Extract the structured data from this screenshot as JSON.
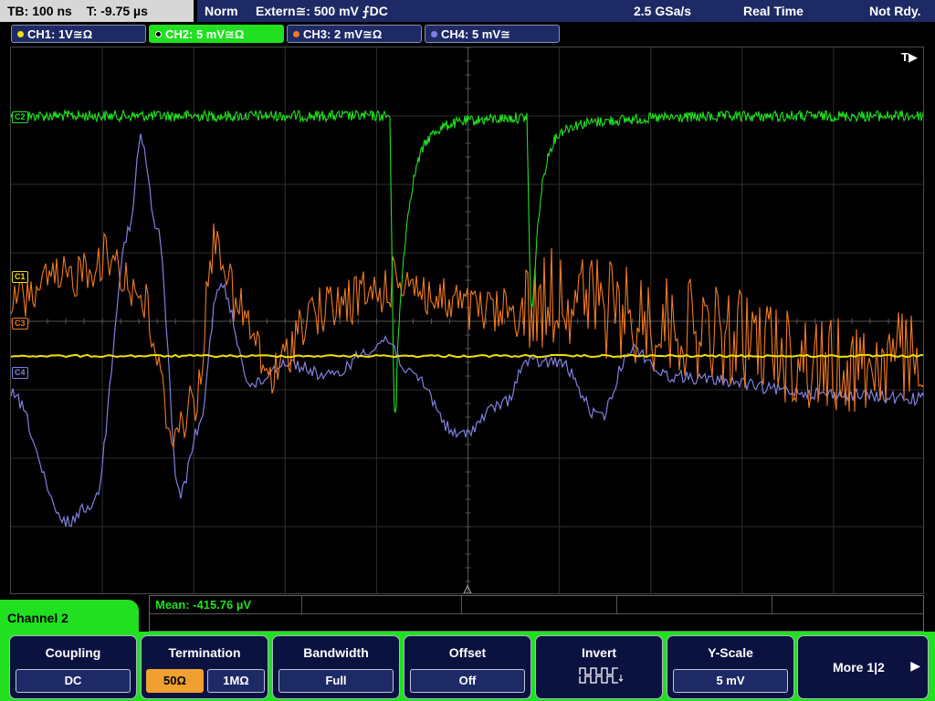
{
  "status": {
    "timebase": "TB: 100 ns",
    "trigger_time": "T: -9.75 µs",
    "mode": "Norm",
    "trigger_source": "Extern≅: 500 mV ⨍DC",
    "sample_rate": "2.5 GSa/s",
    "acq_mode": "Real Time",
    "state": "Not Rdy."
  },
  "channels": [
    {
      "label": "CH1: 1V≅Ω",
      "color": "#f0e000"
    },
    {
      "label": "CH2: 5 mV≅Ω",
      "color": "#20e020"
    },
    {
      "label": "CH3: 2 mV≅Ω",
      "color": "#f07a20"
    },
    {
      "label": "CH4: 5 mV≅",
      "color": "#8080e0"
    }
  ],
  "plot": {
    "trigger_marker": "T▶",
    "markers": [
      {
        "label": "C2"
      },
      {
        "label": "C1"
      },
      {
        "label": "C3"
      },
      {
        "label": "C4"
      }
    ]
  },
  "measurement": {
    "mean": "Mean: -415.76 µV"
  },
  "menu": {
    "title": "Channel 2",
    "coupling": {
      "title": "Coupling",
      "value": "DC"
    },
    "termination": {
      "title": "Termination",
      "opt1": "50Ω",
      "opt2": "1MΩ"
    },
    "bandwidth": {
      "title": "Bandwidth",
      "value": "Full"
    },
    "offset": {
      "title": "Offset",
      "value": "Off"
    },
    "invert": {
      "title": "Invert",
      "icon": "invert-waveform-icon"
    },
    "yscale": {
      "title": "Y-Scale",
      "value": "5 mV"
    },
    "more": {
      "label": "More 1|2"
    }
  }
}
